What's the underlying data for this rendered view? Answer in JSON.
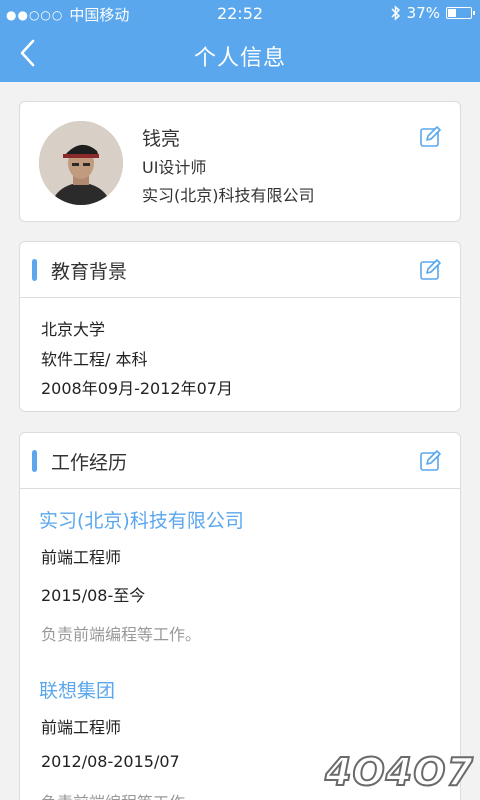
{
  "status_bar": {
    "signal_dots": "●●○○○",
    "carrier": "中国移动",
    "time": "22:52",
    "bluetooth_icon": "bluetooth-icon",
    "battery_percent": "37%",
    "battery_level": 0.37
  },
  "nav": {
    "title": "个人信息",
    "back_icon": "back-chevron-icon"
  },
  "profile": {
    "name": "钱亮",
    "role": "UI设计师",
    "company": "实习(北京)科技有限公司",
    "edit_icon": "edit-icon"
  },
  "education": {
    "title": "教育背景",
    "school": "北京大学",
    "major": "软件工程/ 本科",
    "period": "2008年09月-2012年07月"
  },
  "work": {
    "title": "工作经历",
    "items": [
      {
        "company": "实习(北京)科技有限公司",
        "position": "前端工程师",
        "period": "2015/08-至今",
        "description": "负责前端编程等工作。"
      },
      {
        "company": "联想集团",
        "position": "前端工程师",
        "period": "2012/08-2015/07",
        "description": "负责前端编程等工作。"
      }
    ]
  },
  "watermark": "4O4O7",
  "colors": {
    "accent": "#5aa7ee",
    "background": "#f2f2f2",
    "muted_text": "#999999"
  }
}
